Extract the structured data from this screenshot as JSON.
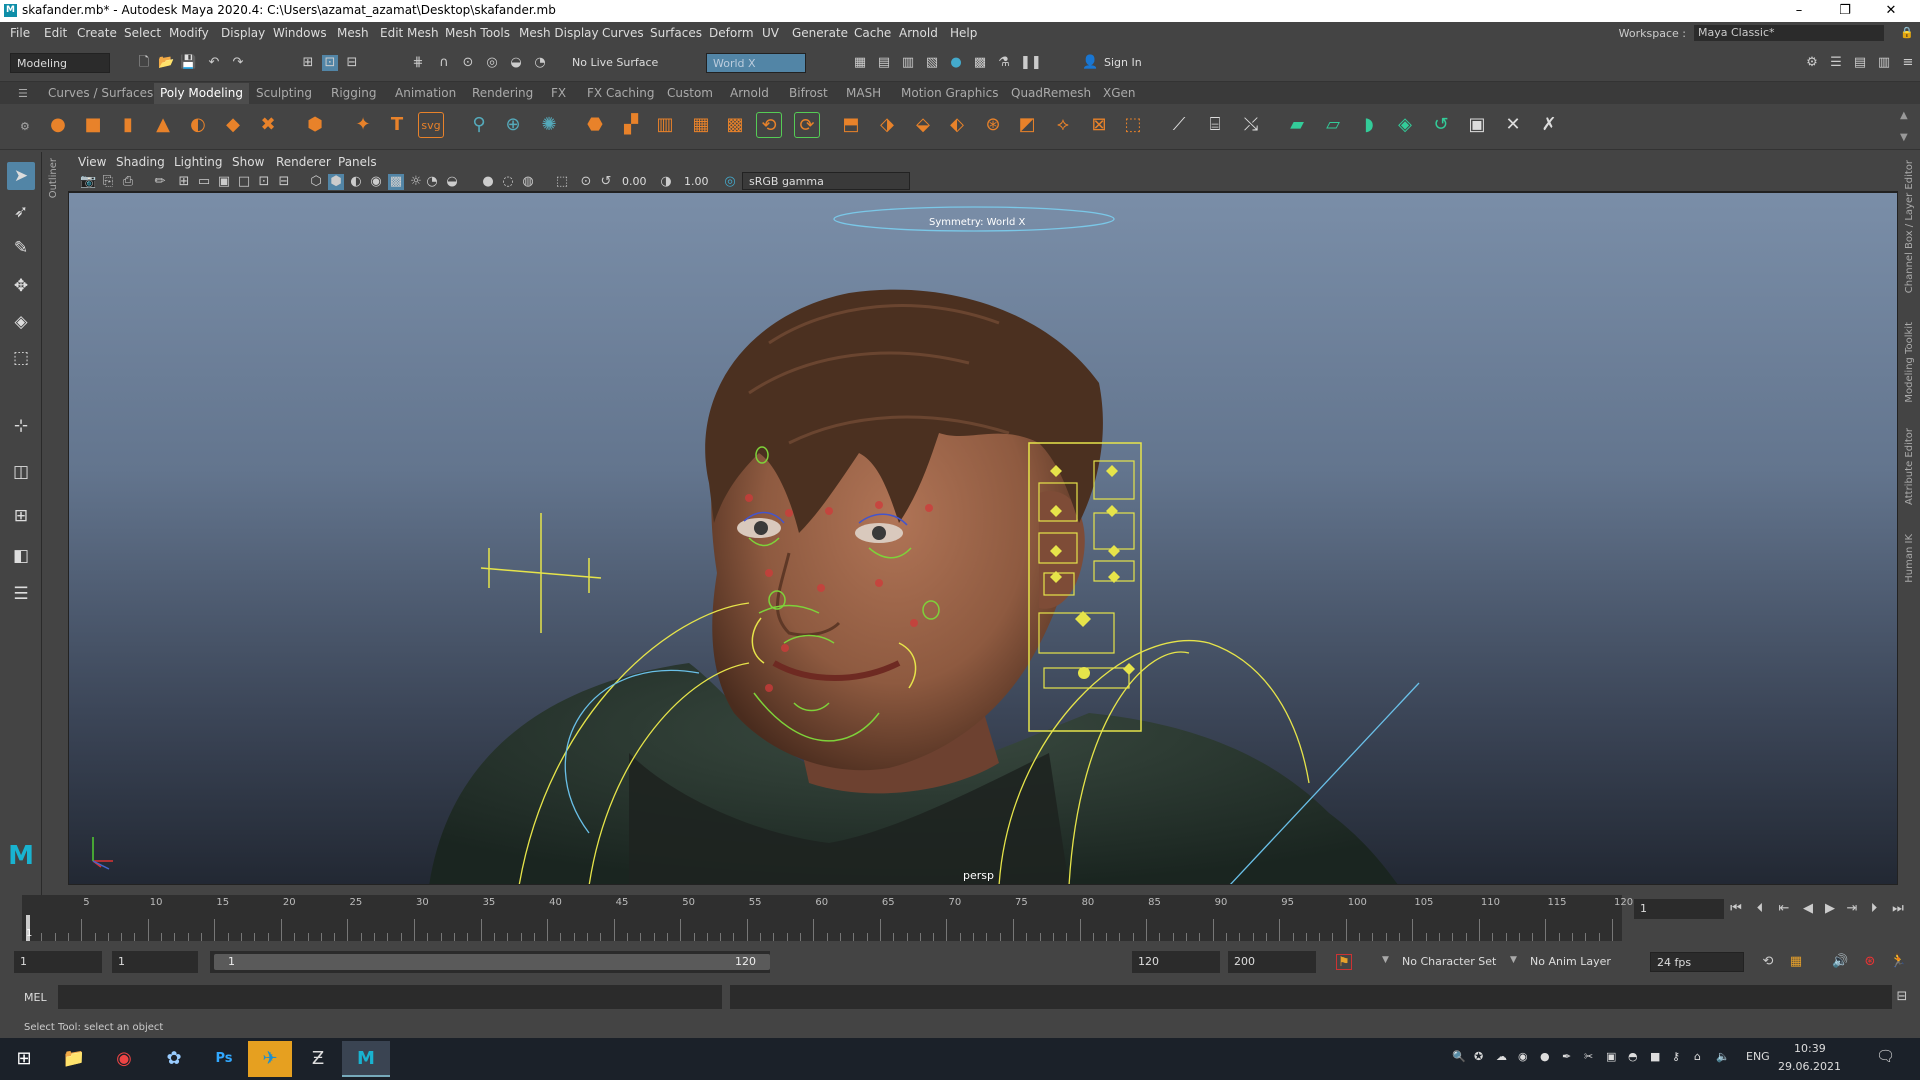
{
  "window": {
    "title": "skafander.mb* - Autodesk Maya 2020.4: C:\\Users\\azamat_azamat\\Desktop\\skafander.mb",
    "min": "–",
    "restore": "❐",
    "close": "✕"
  },
  "menubar": {
    "items": [
      "File",
      "Edit",
      "Create",
      "Select",
      "Modify",
      "Display",
      "Windows",
      "Mesh",
      "Edit Mesh",
      "Mesh Tools",
      "Mesh Display",
      "Curves",
      "Surfaces",
      "Deform",
      "UV",
      "Generate",
      "Cache",
      "Arnold",
      "Help"
    ],
    "workspace_label": "Workspace :",
    "workspace_value": "Maya Classic*"
  },
  "statusline": {
    "mode": "Modeling",
    "live_surface": "No Live Surface",
    "symmetry": "World X",
    "sign_in": "Sign In"
  },
  "shelf": {
    "tabs": [
      "Curves / Surfaces",
      "Poly Modeling",
      "Sculpting",
      "Rigging",
      "Animation",
      "Rendering",
      "FX",
      "FX Caching",
      "Custom",
      "Arnold",
      "Bifrost",
      "MASH",
      "Motion Graphics",
      "QuadRemesh",
      "XGen"
    ],
    "active": "Poly Modeling",
    "svg_label": "svg",
    "text_label": "T"
  },
  "viewport": {
    "menus": [
      "View",
      "Shading",
      "Lighting",
      "Show",
      "Renderer",
      "Panels"
    ],
    "exposure": "0.00",
    "gamma": "1.00",
    "colorspace": "sRGB gamma",
    "symmetry_label": "Symmetry: World X",
    "camera": "persp"
  },
  "side_panels": {
    "outliner": "Outliner",
    "right": [
      "Channel Box / Layer Editor",
      "Modeling Toolkit",
      "Attribute Editor",
      "Human IK"
    ]
  },
  "timeline": {
    "ticks": [
      "5",
      "10",
      "15",
      "20",
      "25",
      "30",
      "35",
      "40",
      "45",
      "50",
      "55",
      "60",
      "65",
      "70",
      "75",
      "80",
      "85",
      "90",
      "95",
      "100",
      "105",
      "110",
      "115",
      "120"
    ],
    "current_marker": "1",
    "current_frame": "1"
  },
  "range": {
    "start": "1",
    "anim_start": "1",
    "slider_start": "1",
    "slider_end": "120",
    "end": "120",
    "anim_end": "200",
    "character_set": "No Character Set",
    "anim_layer": "No Anim Layer",
    "fps": "24 fps"
  },
  "cmdline": {
    "lang": "MEL"
  },
  "helpline": {
    "text": "Select Tool: select an object"
  },
  "taskbar": {
    "lang": "ENG",
    "time": "10:39",
    "date": "29.06.2021",
    "ps_label": "Ps"
  }
}
